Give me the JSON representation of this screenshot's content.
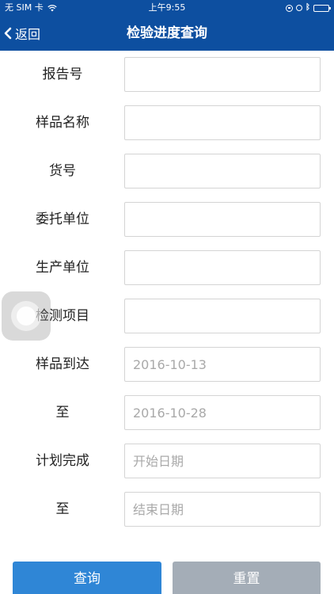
{
  "status_bar": {
    "carrier": "无 SIM 卡",
    "time": "上午9:55",
    "icons": [
      "wifi-icon",
      "rotation-lock-icon",
      "alarm-icon",
      "bluetooth-icon",
      "battery-icon"
    ]
  },
  "nav": {
    "back_label": "返回",
    "title": "检验进度查询"
  },
  "form": {
    "fields": [
      {
        "label": "报告号",
        "value": "",
        "placeholder": ""
      },
      {
        "label": "样品名称",
        "value": "",
        "placeholder": ""
      },
      {
        "label": "货号",
        "value": "",
        "placeholder": ""
      },
      {
        "label": "委托单位",
        "value": "",
        "placeholder": ""
      },
      {
        "label": "生产单位",
        "value": "",
        "placeholder": ""
      },
      {
        "label": "检测项目",
        "value": "",
        "placeholder": ""
      },
      {
        "label": "样品到达",
        "value": "",
        "placeholder": "2016-10-13"
      },
      {
        "label": "至",
        "value": "",
        "placeholder": "2016-10-28"
      },
      {
        "label": "计划完成",
        "value": "",
        "placeholder": "开始日期"
      },
      {
        "label": "至",
        "value": "",
        "placeholder": "结束日期"
      }
    ]
  },
  "buttons": {
    "query_label": "查询",
    "reset_label": "重置"
  },
  "colors": {
    "header": "#0d4fa0",
    "query_button": "#2f86d6",
    "reset_button": "#a4adb7",
    "input_border": "#d4d4d4"
  }
}
